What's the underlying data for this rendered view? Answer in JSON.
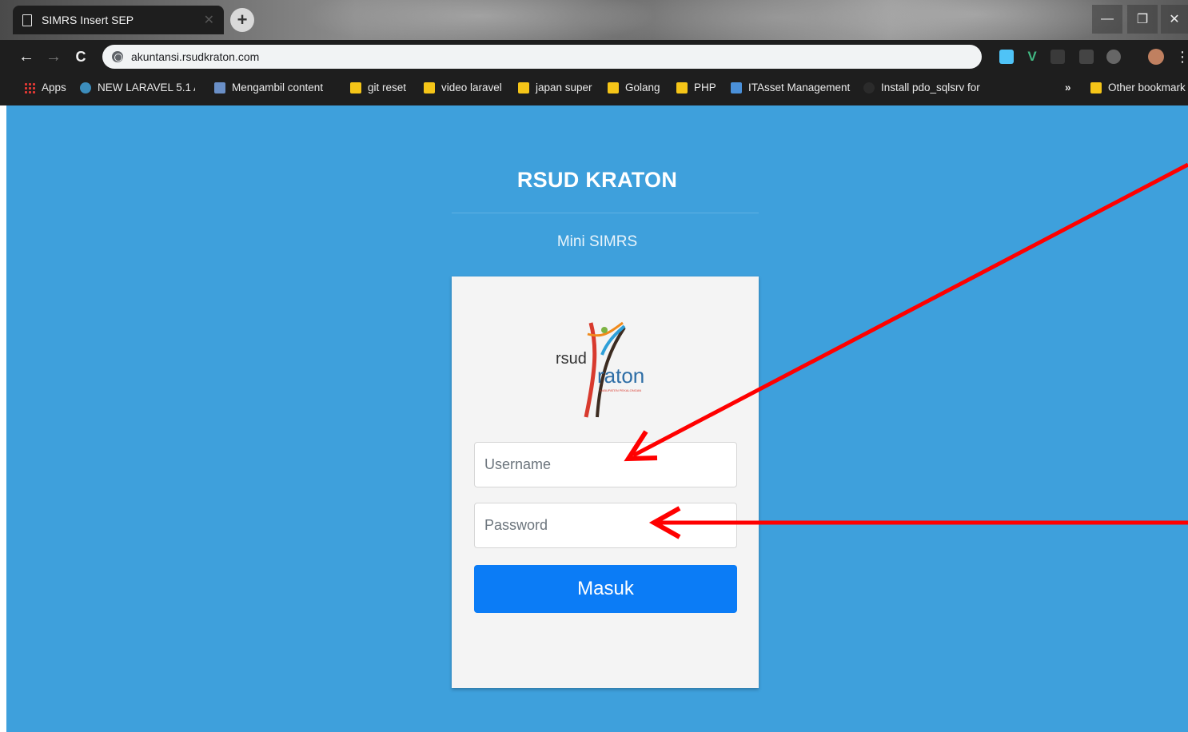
{
  "browser": {
    "tab_title": "SIMRS Insert SEP",
    "new_tab_symbol": "+",
    "url": "akuntansi.rsudkraton.com",
    "bookmarks": [
      {
        "label": "Apps",
        "icon": "apps-grid-icon"
      },
      {
        "label": "NEW LARAVEL 5.1 AC",
        "icon": "wordpress-icon"
      },
      {
        "label": "Mengambil content",
        "icon": "page-icon"
      },
      {
        "label": "git reset",
        "icon": "folder-icon"
      },
      {
        "label": "video laravel",
        "icon": "folder-icon"
      },
      {
        "label": "japan super",
        "icon": "folder-icon"
      },
      {
        "label": "Golang",
        "icon": "folder-icon"
      },
      {
        "label": "PHP",
        "icon": "folder-icon"
      },
      {
        "label": "ITAsset Management",
        "icon": "app-icon"
      },
      {
        "label": "Install pdo_sqlsrv for",
        "icon": "github-icon"
      }
    ],
    "overflow_label": "»",
    "other_bookmarks": "Other bookmark"
  },
  "page": {
    "brand": "RSUD KRATON",
    "subtitle": "Mini SIMRS",
    "logo": {
      "word1": "rsud",
      "word2": "raton",
      "tagline": "KABUPATEN PEKALONGAN"
    },
    "form": {
      "username_placeholder": "Username",
      "password_placeholder": "Password",
      "submit_label": "Masuk"
    },
    "background_color": "#3ea0dc",
    "button_color": "#0b7cf6",
    "annotation_color": "#ff0000"
  }
}
